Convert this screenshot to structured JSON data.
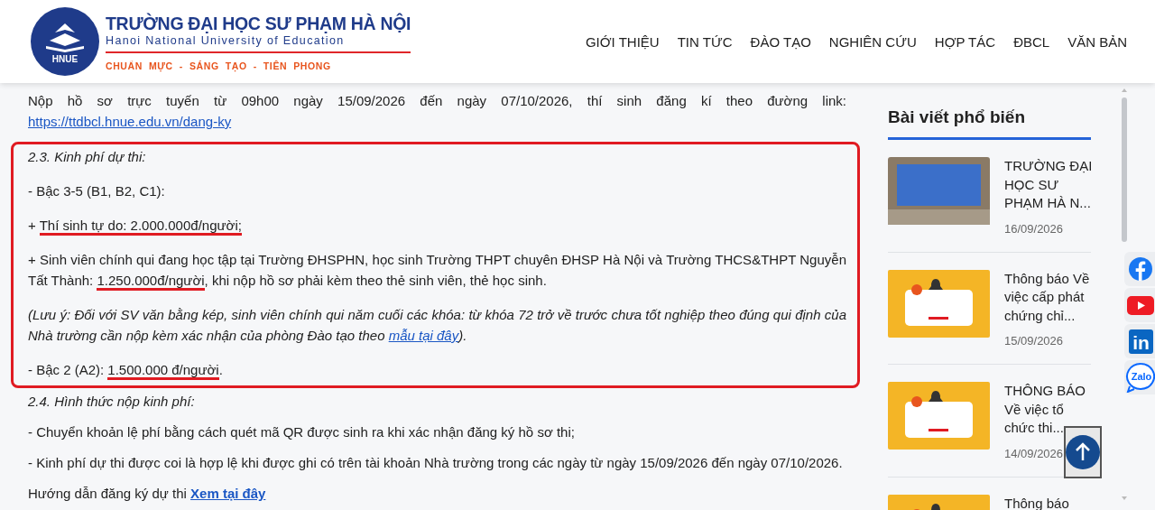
{
  "header": {
    "logo": {
      "label": "HNUE"
    },
    "title": "TRƯỜNG ĐẠI HỌC SƯ PHẠM HÀ NỘI",
    "subtitle": "Hanoi National University of Education",
    "slogan": "CHUẨN  MỰC  -  SÁNG  TẠO  -  TIÊN  PHONG",
    "nav": [
      {
        "label": "GIỚI THIỆU"
      },
      {
        "label": "TIN TỨC"
      },
      {
        "label": "ĐÀO TẠO"
      },
      {
        "label": "NGHIÊN CỨU"
      },
      {
        "label": "HỢP TÁC"
      },
      {
        "label": "ĐBCL"
      },
      {
        "label": "VĂN BẢN"
      }
    ]
  },
  "article": {
    "before": [
      {
        "kind": "text",
        "parts": [
          {
            "kind": "text",
            "text": "Nộp hồ sơ trực tuyến từ 09h00 ngày 15/09/2026 đến ngày 07/10/2026, thí sinh đăng kí theo đường link: "
          },
          {
            "kind": "link",
            "text": "https://ttdbcl.hnue.edu.vn/dang-ky"
          }
        ]
      }
    ],
    "highlight_box": [
      {
        "kind": "heading",
        "parts": [
          {
            "kind": "text",
            "text": "2.3. Kinh phí dự thi:"
          }
        ]
      },
      {
        "kind": "text",
        "parts": [
          {
            "kind": "text",
            "text": "- Bậc 3-5 (B1, B2, C1):"
          }
        ]
      },
      {
        "kind": "text",
        "parts": [
          {
            "kind": "text",
            "text": "+ "
          },
          {
            "kind": "marked",
            "text": "Thí sinh tự do: 2.000.000đ/người;"
          }
        ]
      },
      {
        "kind": "text",
        "parts": [
          {
            "kind": "text",
            "text": "+ Sinh viên chính qui đang học tập tại Trường ĐHSPHN, học sinh Trường THPT chuyên ĐHSP Hà Nội và Trường THCS&THPT Nguyễn Tất Thành: "
          },
          {
            "kind": "marked",
            "text": "1.250.000đ/người"
          },
          {
            "kind": "text",
            "text": ", khi nộp hồ sơ phải kèm theo thẻ sinh viên, thẻ học sinh."
          }
        ]
      },
      {
        "kind": "note",
        "parts": [
          {
            "kind": "text",
            "text": "(Lưu ý: Đối với SV văn bằng kép, sinh viên chính qui năm cuối các khóa: từ khóa 72 trở về trước chưa tốt nghiệp theo đúng qui định của Nhà trường cần nộp kèm xác nhận của phòng Đào tạo theo "
          },
          {
            "kind": "link",
            "text": "mẫu tại đây"
          },
          {
            "kind": "text",
            "text": ")."
          }
        ]
      },
      {
        "kind": "text",
        "parts": [
          {
            "kind": "text",
            "text": "- Bậc 2 (A2): "
          },
          {
            "kind": "marked",
            "text": "1.500.000 đ/người"
          },
          {
            "kind": "text",
            "text": "."
          }
        ]
      }
    ],
    "after": [
      {
        "kind": "heading",
        "parts": [
          {
            "kind": "text",
            "text": "2.4. Hình thức nộp kinh phí:"
          }
        ]
      },
      {
        "kind": "text",
        "parts": [
          {
            "kind": "text",
            "text": "- Chuyển khoản lệ phí bằng cách quét mã QR được sinh ra khi xác nhận đăng ký hồ sơ thi;"
          }
        ]
      },
      {
        "kind": "text",
        "parts": [
          {
            "kind": "text",
            "text": "- Kinh phí dự thi được coi là hợp lệ khi được ghi có trên tài khoản Nhà trường trong các ngày từ ngày 15/09/2026 đến ngày 07/10/2026."
          }
        ]
      },
      {
        "kind": "text",
        "parts": [
          {
            "kind": "text",
            "text": "Hướng dẫn đăng ký dự thi "
          },
          {
            "kind": "strong_link",
            "text": "Xem tại đây"
          }
        ]
      }
    ]
  },
  "sidebar": {
    "title": "Bài viết phổ biến",
    "posts": [
      {
        "kind": "photo",
        "title": "TRƯỜNG ĐẠI HỌC SƯ PHẠM HÀ N...",
        "date": "16/09/2026"
      },
      {
        "kind": "notice",
        "title": "Thông báo Về việc cấp phát chứng chỉ...",
        "date": "15/09/2026"
      },
      {
        "kind": "notice",
        "title": "THÔNG BÁO Về việc tổ chức thi...",
        "date": "14/09/2026"
      },
      {
        "kind": "notice",
        "title": "Thông báo"
      }
    ]
  },
  "social": [
    {
      "kind": "facebook"
    },
    {
      "kind": "youtube"
    },
    {
      "kind": "linkedin",
      "label": "in"
    },
    {
      "kind": "zalo",
      "label": "Zalo"
    }
  ]
}
